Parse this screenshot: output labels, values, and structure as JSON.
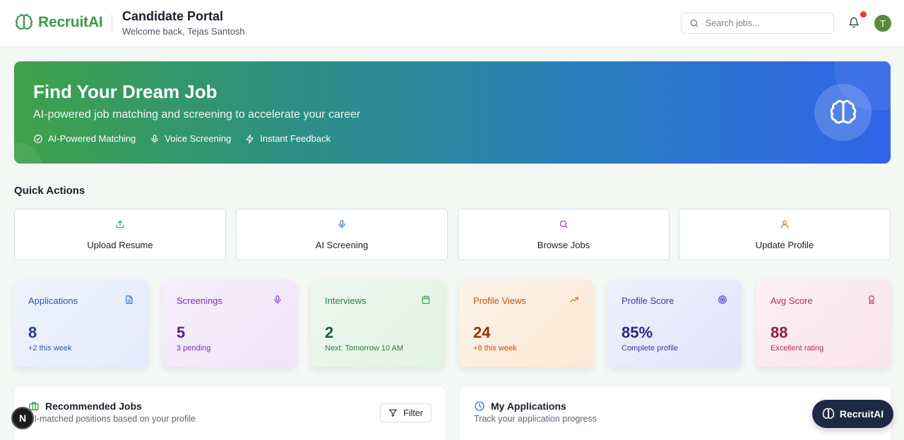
{
  "header": {
    "brand": "RecruitAI",
    "portal_title": "Candidate Portal",
    "welcome": "Welcome back, Tejas Santosh",
    "search_placeholder": "Search jobs...",
    "avatar_initial": "T",
    "notification_dot_color": "#ef3b3b"
  },
  "hero": {
    "title": "Find Your Dream Job",
    "subtitle": "AI-powered job matching and screening to accelerate your career",
    "features": [
      {
        "icon": "check-circle-icon",
        "label": "AI-Powered Matching"
      },
      {
        "icon": "mic-icon",
        "label": "Voice Screening"
      },
      {
        "icon": "zap-icon",
        "label": "Instant Feedback"
      }
    ]
  },
  "quick_actions": {
    "title": "Quick Actions",
    "items": [
      {
        "icon": "upload-icon",
        "label": "Upload Resume",
        "color": "#3a9a4b"
      },
      {
        "icon": "mic-icon",
        "label": "AI Screening",
        "color": "#3b6fd4"
      },
      {
        "icon": "search-icon",
        "label": "Browse Jobs",
        "color": "#8a3fd1"
      },
      {
        "icon": "user-icon",
        "label": "Update Profile",
        "color": "#e06a1c"
      }
    ]
  },
  "stats": [
    {
      "label": "Applications",
      "value": "8",
      "note": "+2 this week",
      "icon": "file-icon",
      "color": "#2f52b8"
    },
    {
      "label": "Screenings",
      "value": "5",
      "note": "3 pending",
      "icon": "mic-icon",
      "color": "#7a2fb8"
    },
    {
      "label": "Interviews",
      "value": "2",
      "note": "Next: Tomorrow 10 AM",
      "icon": "calendar-icon",
      "color": "#2f7a3c"
    },
    {
      "label": "Profile Views",
      "value": "24",
      "note": "+8 this week",
      "icon": "trending-up-icon",
      "color": "#c0520f"
    },
    {
      "label": "Profile Score",
      "value": "85%",
      "note": "Complete profile",
      "icon": "target-icon",
      "color": "#3b36a8"
    },
    {
      "label": "Avg Score",
      "value": "88",
      "note": "Excellent rating",
      "icon": "award-icon",
      "color": "#b42a5c"
    }
  ],
  "panels": {
    "recommended": {
      "title": "Recommended Jobs",
      "subtitle": "AI-matched positions based on your profile",
      "filter_label": "Filter"
    },
    "applications": {
      "title": "My Applications",
      "subtitle": "Track your application progress"
    }
  },
  "floating": {
    "dev_badge": "N",
    "brand_button": "RecruitAI"
  }
}
